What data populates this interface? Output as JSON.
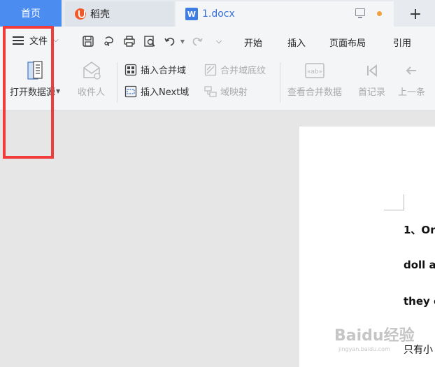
{
  "tabs": {
    "home": "首页",
    "doke": "稻壳",
    "doc": "1.docx",
    "doc_icon_letter": "W",
    "add": "+"
  },
  "toolbar": {
    "file_menu": "文件",
    "menus": [
      "开始",
      "插入",
      "页面布局",
      "引用"
    ]
  },
  "ribbon": {
    "open_datasource": "打开数据源",
    "recipient": "收件人",
    "insert_merge_field": "插入合并域",
    "insert_next_field": "插入Next域",
    "merge_field_shading": "合并域底纹",
    "field_mapping": "域映射",
    "view_merged_data": "查看合并数据",
    "first_record": "首记录",
    "prev_record": "上一条"
  },
  "document": {
    "line1": "1、Or",
    "line2": "doll a",
    "line3": "they c",
    "line4": "只有小"
  },
  "watermark": {
    "brand": "Baidu经验",
    "url": "jingyan.baidu.com"
  },
  "colors": {
    "accent": "#4a8cf0",
    "highlight": "#f03c3c"
  }
}
